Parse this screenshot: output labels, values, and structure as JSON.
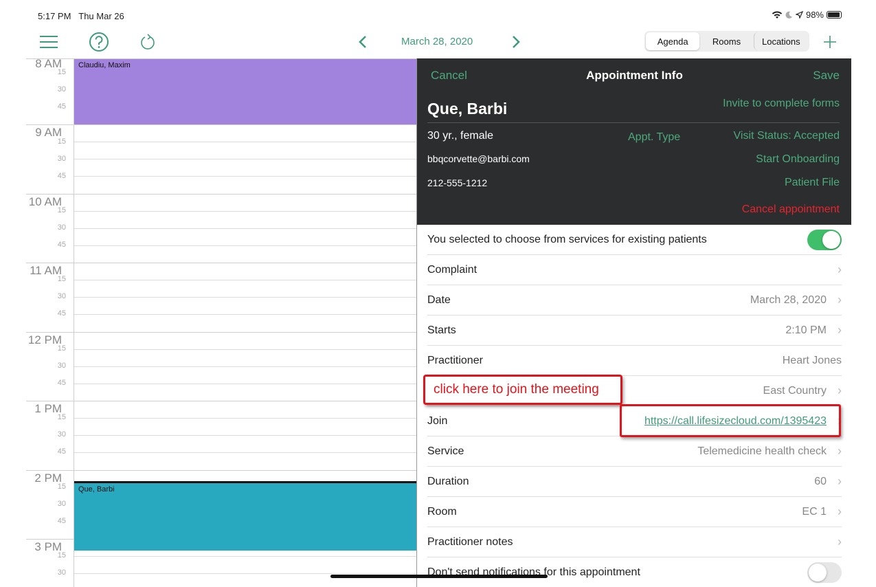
{
  "status": {
    "time": "5:17 PM",
    "date": "Thu Mar 26",
    "battery": "98%"
  },
  "toolbar": {
    "date": "March 28, 2020",
    "segments": [
      "Agenda",
      "Rooms",
      "Locations"
    ],
    "active_segment": "Agenda",
    "icons": [
      "menu-icon",
      "help-icon",
      "refresh-icon",
      "chevron-left-icon",
      "chevron-right-icon",
      "plus-icon"
    ]
  },
  "calendar": {
    "hours": [
      "8 AM",
      "9 AM",
      "10 AM",
      "11 AM",
      "12 PM",
      "1 PM",
      "2 PM",
      "3 PM"
    ],
    "quarters": [
      "15",
      "30",
      "45"
    ],
    "events": [
      {
        "title": "Claudiu, Maxim",
        "color": "#a182dc"
      },
      {
        "title": "Que, Barbi",
        "color": "#28a9bf"
      }
    ]
  },
  "panel": {
    "cancel": "Cancel",
    "title": "Appointment Info",
    "save": "Save",
    "patient_name": "Que, Barbi",
    "invite": "Invite to complete forms",
    "age_gender": "30 yr., female",
    "appt_type": "Appt. Type",
    "visit_status": "Visit Status: Accepted",
    "email": "bbqcorvette@barbi.com",
    "start_onboarding": "Start Onboarding",
    "phone": "212-555-1212",
    "patient_file": "Patient File",
    "cancel_appointment": "Cancel appointment",
    "rows": {
      "existing": {
        "label": "You selected to choose from services for existing patients",
        "toggle": "on"
      },
      "complaint": {
        "label": "Complaint",
        "value": ""
      },
      "date": {
        "label": "Date",
        "value": "March 28, 2020"
      },
      "starts": {
        "label": "Starts",
        "value": "2:10 PM"
      },
      "practitioner": {
        "label": "Practitioner",
        "value": "Heart Jones"
      },
      "location": {
        "label": "",
        "value": "East Country"
      },
      "join": {
        "label": "Join",
        "value": "https://call.lifesizecloud.com/1395423"
      },
      "service": {
        "label": "Service",
        "value": "Telemedicine health check"
      },
      "duration": {
        "label": "Duration",
        "value": "60"
      },
      "room": {
        "label": "Room",
        "value": "EC 1"
      },
      "notes": {
        "label": "Practitioner notes",
        "value": ""
      },
      "notifications": {
        "label": "Don't send notifications for this appointment",
        "toggle": "off"
      }
    }
  },
  "annotation": {
    "text": "click here to join the meeting",
    "color": "#e1141b"
  },
  "colors": {
    "accent": "#3f9c78",
    "header_bg": "#2b2d2e",
    "danger": "#e8232d"
  }
}
